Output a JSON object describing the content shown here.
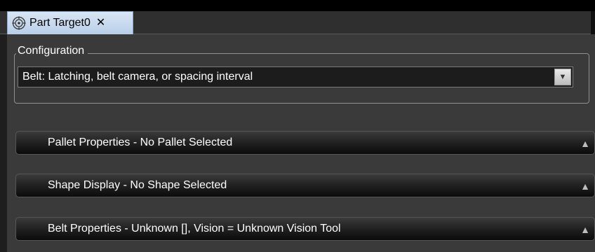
{
  "tab": {
    "title": "Part Target0",
    "close": "✕",
    "icon": "target-icon"
  },
  "configuration": {
    "legend": "Configuration",
    "selected": "Belt: Latching, belt camera, or spacing interval",
    "dropdown_glyph": "▼"
  },
  "sections": [
    {
      "label": "Pallet Properties - No Pallet Selected",
      "glyph": "▲"
    },
    {
      "label": "Shape Display - No Shape Selected",
      "glyph": "▲"
    },
    {
      "label": "Belt Properties -  Unknown [], Vision = Unknown Vision Tool",
      "glyph": "▲"
    }
  ]
}
